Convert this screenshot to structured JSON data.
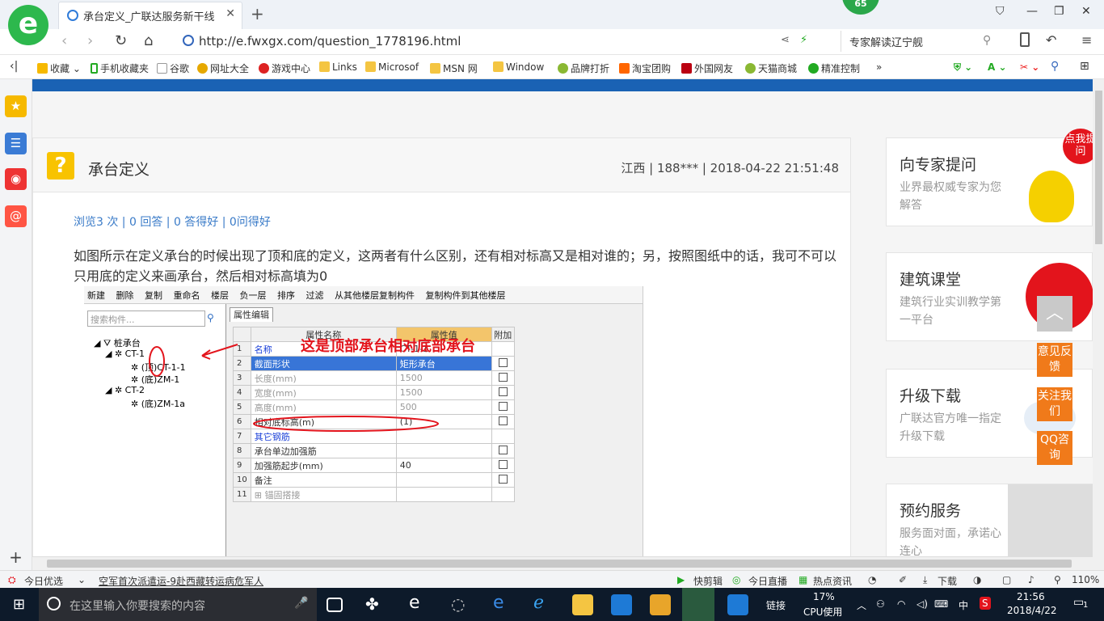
{
  "browser": {
    "tab_title": "承台定义_广联达服务新干线",
    "badge": "65",
    "url": "http://e.fwxgx.com/question_1778196.html",
    "search_text": "专家解读辽宁舰",
    "bookmarks": [
      "收藏",
      "手机收藏夹",
      "谷歌",
      "网址大全",
      "游戏中心",
      "Links",
      "Microsof",
      "MSN 网",
      "Window",
      "品牌打折",
      "淘宝团购",
      "外国网友",
      "天猫商城",
      "精准控制"
    ],
    "zoom": "110%"
  },
  "question": {
    "title": "承台定义",
    "meta": "江西 | 188*** | 2018-04-22 21:51:48",
    "stats": "浏览3 次 | 0 回答 | 0 答得好 | 0问得好",
    "text": "如图所示在定义承台的时候出现了顶和底的定义，这两者有什么区别，还有相对标高又是相对谁的；另，按照图纸中的话，我可不可以只用底的定义来画承台，然后相对标高填为0"
  },
  "screenshot": {
    "toolbar": [
      "新建",
      "删除",
      "复制",
      "重命名",
      "楼层",
      "负一层",
      "排序",
      "过滤",
      "从其他楼层复制构件",
      "复制构件到其他楼层"
    ],
    "search_placeholder": "搜索构件...",
    "tree": [
      "桩承台",
      "CT-1",
      "(顶)CT-1-1",
      "(底)ZM-1",
      "CT-2",
      "(底)ZM-1a"
    ],
    "prop_tab": "属性编辑",
    "columns": [
      "属性名称",
      "属性值",
      "附加"
    ],
    "rows": [
      {
        "n": "1",
        "name": "名称",
        "value": "CT-1-1"
      },
      {
        "n": "2",
        "name": "截面形状",
        "value": "矩形承台"
      },
      {
        "n": "3",
        "name": "长度(mm)",
        "value": "1500"
      },
      {
        "n": "4",
        "name": "宽度(mm)",
        "value": "1500"
      },
      {
        "n": "5",
        "name": "高度(mm)",
        "value": "500"
      },
      {
        "n": "6",
        "name": "相对底标高(m)",
        "value": "(1)"
      },
      {
        "n": "7",
        "name": "其它钢筋",
        "value": ""
      },
      {
        "n": "8",
        "name": "承台单边加强筋",
        "value": ""
      },
      {
        "n": "9",
        "name": "加强筋起步(mm)",
        "value": "40"
      },
      {
        "n": "10",
        "name": "备注",
        "value": ""
      },
      {
        "n": "11",
        "name": "锚固搭接",
        "value": ""
      }
    ],
    "annotation": "这是顶部承台相对底部承台"
  },
  "sidebar": {
    "cards": [
      {
        "title": "向专家提问",
        "sub": "业界最权威专家为您解答",
        "badge": "点我提问"
      },
      {
        "title": "建筑课堂",
        "sub": "建筑行业实训教学第一平台"
      },
      {
        "title": "升级下载",
        "sub": "广联达官方唯一指定升级下载"
      },
      {
        "title": "预约服务",
        "sub": "服务面对面，承诺心连心"
      }
    ],
    "floats": [
      "意见反馈",
      "关注我们",
      "QQ咨询"
    ]
  },
  "statusbar": {
    "items": [
      "今日优选",
      "空军首次派遣运-9赴西藏转运病危军人",
      "快剪辑",
      "今日直播",
      "热点资讯",
      "下载"
    ]
  },
  "taskbar": {
    "search_placeholder": "在这里输入你要搜索的内容",
    "link": "链接",
    "cpu": "17%",
    "cpu_label": "CPU使用",
    "ime": "中",
    "time": "21:56",
    "date": "2018/4/22",
    "notif": "1"
  }
}
